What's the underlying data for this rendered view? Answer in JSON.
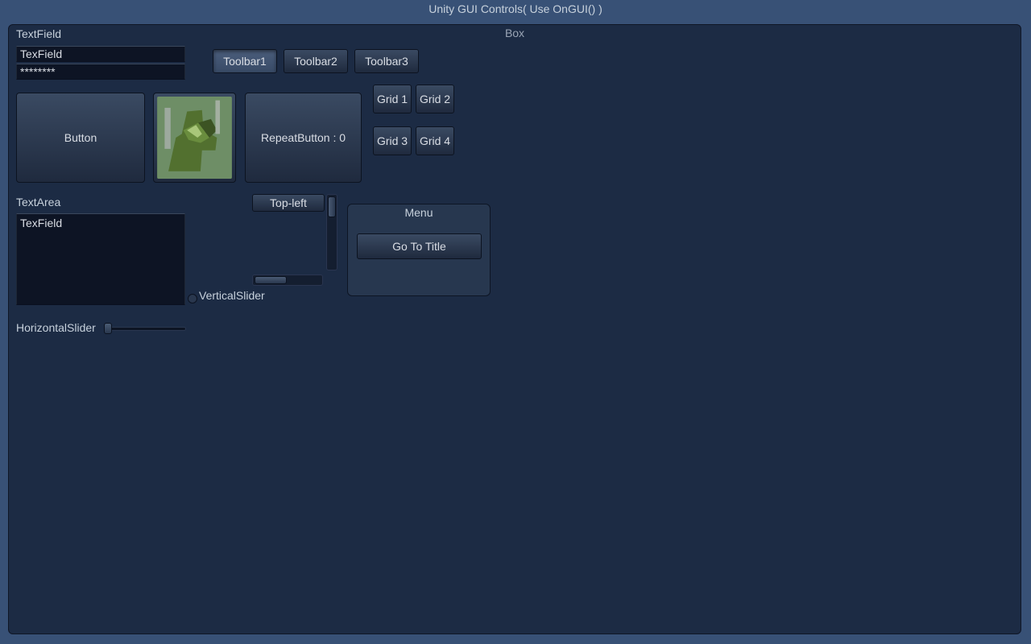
{
  "title": "Unity GUI Controls( Use OnGUI() )",
  "box": {
    "title": "Box"
  },
  "textfield_label": "TextField",
  "textfield_value": "TexField",
  "password_value": "********",
  "toolbar": [
    "Toolbar1",
    "Toolbar2",
    "Toolbar3"
  ],
  "button_label": "Button",
  "repeat_button_label": "RepeatButton : 0",
  "grid": [
    "Grid 1",
    "Grid 2",
    "Grid 3",
    "Grid 4"
  ],
  "textarea_label": "TextArea",
  "textarea_value": "TexField",
  "verticalslider_label": "VerticalSlider",
  "horizontalslider_label": "HorizontalSlider",
  "scrollview_button": "Top-left",
  "menu": {
    "title": "Menu",
    "button": "Go To Title"
  }
}
